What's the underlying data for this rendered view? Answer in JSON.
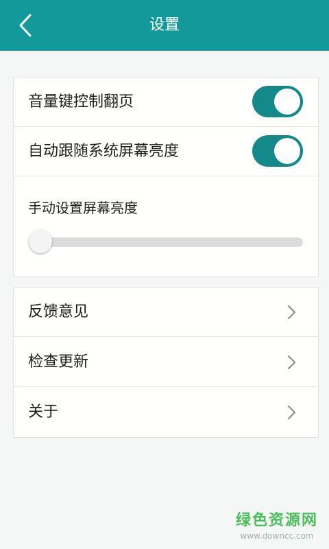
{
  "header": {
    "title": "设置",
    "back_icon": "chevron-left-icon",
    "color": "#14999a"
  },
  "settings": {
    "volume_page_turn": {
      "label": "音量键控制翻页",
      "enabled": true
    },
    "auto_brightness": {
      "label": "自动跟随系统屏幕亮度",
      "enabled": true
    },
    "manual_brightness": {
      "label": "手动设置屏幕亮度",
      "value_percent": 0
    }
  },
  "menu": [
    {
      "label": "反馈意见",
      "icon": "chevron-right-icon"
    },
    {
      "label": "检查更新",
      "icon": "chevron-right-icon"
    },
    {
      "label": "关于",
      "icon": "chevron-right-icon"
    }
  ],
  "watermark": {
    "text": "绿色资源网",
    "url": "www.downcc.com"
  },
  "colors": {
    "accent": "#13898a",
    "toolbar": "#14999a",
    "background": "#f4f7f6"
  }
}
